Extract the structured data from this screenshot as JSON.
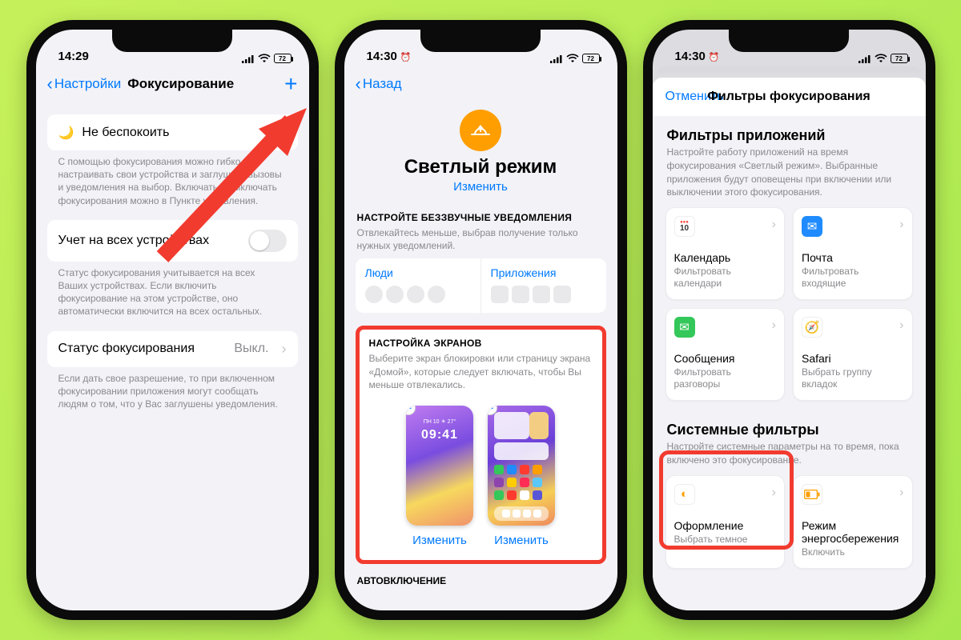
{
  "status": {
    "time1": "14:29",
    "time2": "14:30",
    "time3": "14:30",
    "battery": "72"
  },
  "p1": {
    "back": "Настройки",
    "title": "Фокусирование",
    "dnd": "Не беспокоить",
    "dnd_footer": "С помощью фокусирования можно гибко настраивать свои устройства и заглушать вызовы и уведомления на выбор. Включать и выключать фокусирования можно в Пункте управления.",
    "share": "Учет на всех устройствах",
    "share_footer": "Статус фокусирования учитывается на всех Ваших устройствах. Если включить фокусирование на этом устройстве, оно автоматически включится на всех остальных.",
    "status_row": "Статус фокусирования",
    "status_value": "Выкл.",
    "status_footer": "Если дать свое разрешение, то при включенном фокусировании приложения могут сообщать людям о том, что у Вас заглушены уведомления."
  },
  "p2": {
    "back": "Назад",
    "hero_title": "Светлый режим",
    "hero_edit": "Изменить",
    "silent_head": "НАСТРОЙТЕ БЕЗЗВУЧНЫЕ УВЕДОМЛЕНИЯ",
    "silent_sub": "Отвлекайтесь меньше, выбрав получение только нужных уведомлений.",
    "people": "Люди",
    "apps": "Приложения",
    "screens_head": "НАСТРОЙКА ЭКРАНОВ",
    "screens_sub": "Выберите экран блокировки или страницу экрана «Домой», которые следует включать, чтобы Вы меньше отвлекались.",
    "lock_time": "09:41",
    "edit": "Изменить",
    "auto": "АВТОВКЛЮЧЕНИЕ"
  },
  "p3": {
    "cancel": "Отменить",
    "title": "Фильтры фокусирования",
    "apps_title": "Фильтры приложений",
    "apps_desc": "Настройте работу приложений на время фокусирования «Светлый режим». Выбранные приложения будут оповещены при включении или выключении этого фокусирования.",
    "tiles": {
      "cal": {
        "name": "Календарь",
        "sub": "Фильтровать календари"
      },
      "mail": {
        "name": "Почта",
        "sub": "Фильтровать входящие"
      },
      "msg": {
        "name": "Сообщения",
        "sub": "Фильтровать разговоры"
      },
      "saf": {
        "name": "Safari",
        "sub": "Выбрать группу вкладок"
      }
    },
    "sys_title": "Системные фильтры",
    "sys_desc": "Настройте системные параметры на то время, пока включено это фокусирование.",
    "appearance": {
      "name": "Оформление",
      "sub": "Выбрать темное"
    },
    "power": {
      "name": "Режим энергосбережения",
      "sub": "Включить"
    }
  }
}
